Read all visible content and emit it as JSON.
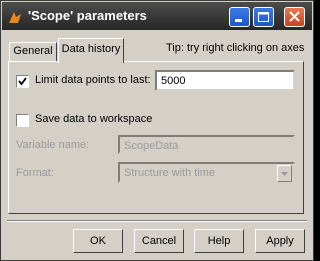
{
  "window": {
    "title": "'Scope' parameters",
    "controls": [
      "minimize-icon",
      "maximize-icon",
      "close-icon"
    ]
  },
  "tabs": [
    {
      "label": "General",
      "active": false
    },
    {
      "label": "Data history",
      "active": true
    }
  ],
  "tip": "Tip: try right clicking on axes",
  "limit": {
    "label": "Limit data points to last:",
    "checked": true,
    "value": "5000"
  },
  "save": {
    "label": "Save data to workspace",
    "checked": false
  },
  "variable": {
    "label": "Variable name:",
    "value": "ScopeData",
    "enabled": false
  },
  "format": {
    "label": "Format:",
    "value": "Structure with time",
    "enabled": false
  },
  "buttons": {
    "ok": "OK",
    "cancel": "Cancel",
    "help": "Help",
    "apply": "Apply"
  },
  "colors": {
    "titlebar": "#333333",
    "window": "#d4d0c8",
    "disabled_text": "#9a9a9a",
    "minmax": "#2b63d6",
    "close": "#d9582f"
  }
}
